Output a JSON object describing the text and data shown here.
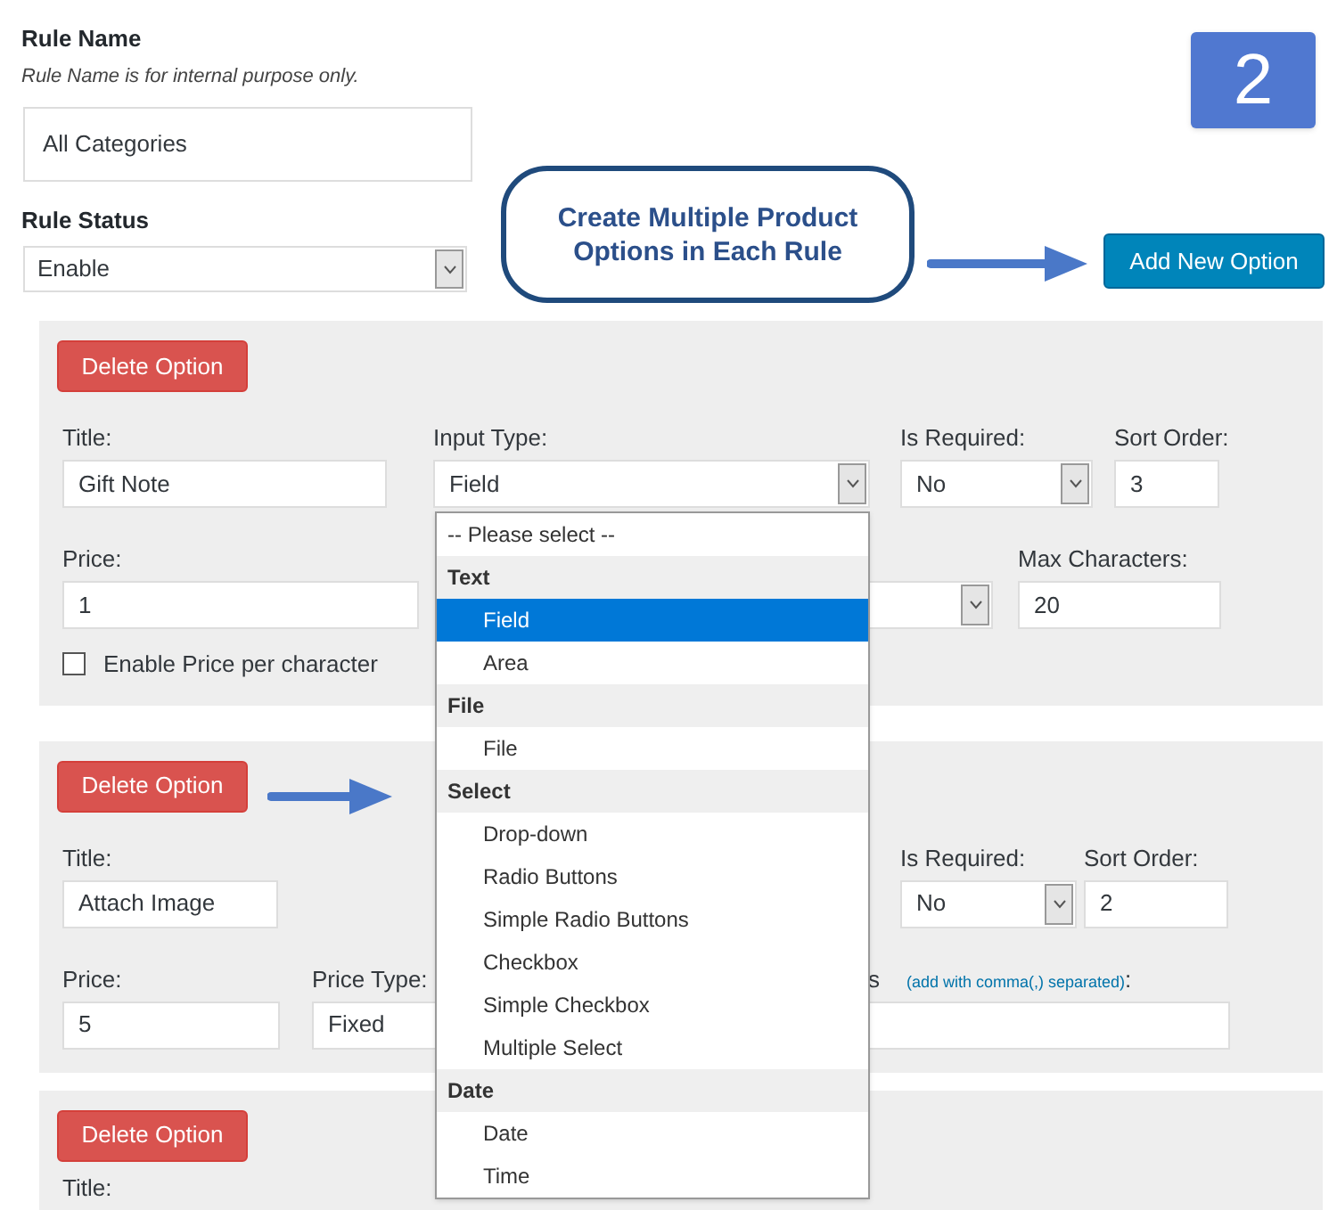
{
  "rule_name": {
    "label": "Rule Name",
    "hint": "Rule Name is for internal purpose only.",
    "value": "All Categories"
  },
  "rule_status": {
    "label": "Rule Status",
    "value": "Enable"
  },
  "step_badge": "2",
  "callout": "Create Multiple Product Options in Each Rule",
  "add_button": "Add New Option",
  "options": [
    {
      "delete_button": "Delete Option",
      "fields": [
        {
          "kind": "input",
          "label": "Title:",
          "value": "Gift Note"
        },
        {
          "kind": "select",
          "label": "Input Type:",
          "value": "Field"
        },
        {
          "kind": "select",
          "label": "Is Required:",
          "value": "No"
        },
        {
          "kind": "input",
          "label": "Sort Order:",
          "value": "3"
        },
        {
          "kind": "input",
          "label": "Price:",
          "value": "1"
        },
        {
          "kind": "select"
        },
        {
          "kind": "input",
          "label": "Max Characters:",
          "value": "20"
        }
      ],
      "checkbox": {
        "label": "Enable Price per character",
        "checked": false
      }
    },
    {
      "delete_button": "Delete Option",
      "fields": [
        {
          "kind": "input",
          "label": "Title:",
          "value": "Attach Image"
        },
        {
          "kind": "select",
          "label": "Is Required:",
          "value": "No"
        },
        {
          "kind": "input",
          "label": "Sort Order:",
          "value": "2"
        },
        {
          "kind": "input",
          "label": "Price:",
          "value": "5"
        },
        {
          "kind": "select",
          "label": "Price Type:",
          "value": "Fixed"
        },
        {
          "kind": "input",
          "label": "s",
          "note": "(add with comma(,) separated)",
          "label_end": ":"
        }
      ]
    },
    {
      "delete_button": "Delete Option",
      "fields": [
        {
          "kind": "label",
          "label": "Title:"
        }
      ]
    }
  ],
  "dropdown": {
    "items": [
      {
        "kind": "placeholder",
        "label": "-- Please select --",
        "selected": false
      },
      {
        "kind": "group",
        "label": "Text"
      },
      {
        "kind": "option",
        "label": "Field",
        "selected": true
      },
      {
        "kind": "option",
        "label": "Area",
        "selected": false
      },
      {
        "kind": "group",
        "label": "File"
      },
      {
        "kind": "option",
        "label": "File",
        "selected": false
      },
      {
        "kind": "group",
        "label": "Select"
      },
      {
        "kind": "option",
        "label": "Drop-down",
        "selected": false
      },
      {
        "kind": "option",
        "label": "Radio Buttons",
        "selected": false
      },
      {
        "kind": "option",
        "label": "Simple Radio Buttons",
        "selected": false
      },
      {
        "kind": "option",
        "label": "Checkbox",
        "selected": false
      },
      {
        "kind": "option",
        "label": "Simple Checkbox",
        "selected": false
      },
      {
        "kind": "option",
        "label": "Multiple Select",
        "selected": false
      },
      {
        "kind": "group",
        "label": "Date"
      },
      {
        "kind": "option",
        "label": "Date",
        "selected": false
      },
      {
        "kind": "option",
        "label": "Time",
        "selected": false
      }
    ]
  }
}
